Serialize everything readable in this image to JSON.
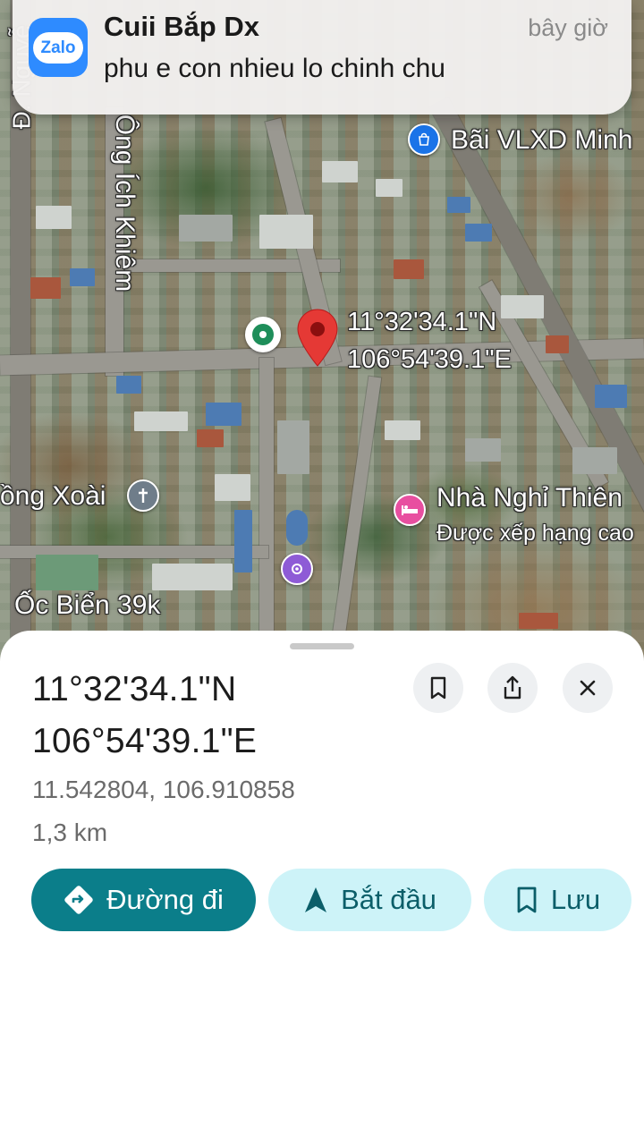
{
  "notification": {
    "app_icon": "zalo-icon",
    "app_icon_text": "Zalo",
    "sender": "Cuii Bắp Dx",
    "time": "bây giờ",
    "message": "phu e con nhieu lo chinh chu"
  },
  "map": {
    "labels": {
      "street_top_left": "Đ. Nguyễ",
      "street_vertical": "Ông Ích Khiêm",
      "place_top_right": "Bãi VLXD Minh",
      "pin_lat": "11°32'34.1\"N",
      "pin_lng": "106°54'39.1\"E",
      "church": "ồng Xoài",
      "guesthouse": "Nhà Nghỉ Thiên",
      "guesthouse_sub": "Được xếp hạng cao",
      "restaurant": "Ốc Biển 39k"
    },
    "icons": [
      "shopping-bag-icon",
      "location-pin-icon",
      "green-dot-icon",
      "church-cross-icon",
      "bed-icon",
      "sparkle-icon"
    ],
    "colors": {
      "pin": "#e53935",
      "poi_blue": "#1a73e8",
      "poi_pink": "#e84fa0",
      "poi_purple": "#8e5bd6",
      "poi_green": "#1e8e5a",
      "poi_grey": "#6f7d8a"
    }
  },
  "sheet": {
    "coord_lat": "11°32'34.1\"N",
    "coord_lng": "106°54'39.1\"E",
    "decimal": "11.542804, 106.910858",
    "distance": "1,3 km",
    "buttons": {
      "directions": "Đường đi",
      "start": "Bắt đầu",
      "save": "Lưu"
    },
    "icons": [
      "bookmark-icon",
      "share-icon",
      "close-icon",
      "directions-icon",
      "navigation-arrow-icon",
      "bookmark-outline-icon"
    ],
    "colors": {
      "primary": "#0b7e8a",
      "secondary_bg": "#cdf3f8",
      "secondary_fg": "#0b5e69"
    }
  }
}
